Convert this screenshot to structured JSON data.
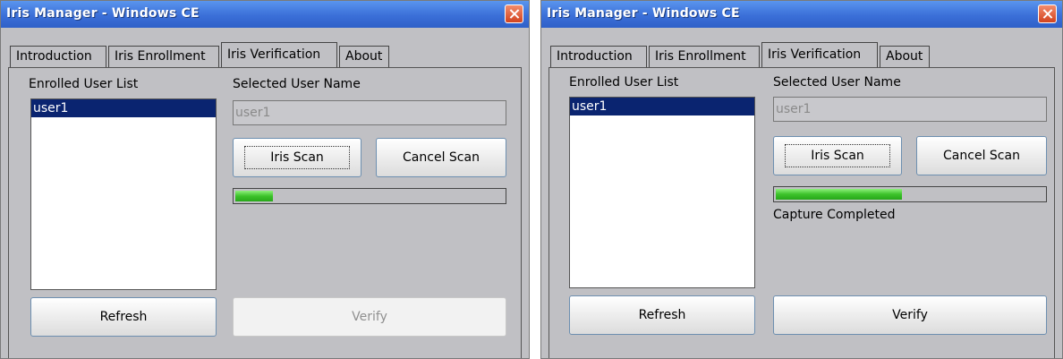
{
  "windows": [
    {
      "title": "Iris Manager - Windows CE",
      "tabs": [
        "Introduction",
        "Iris Enrollment",
        "Iris Verification",
        "About"
      ],
      "active_tab": "Iris Verification",
      "enrolled_label": "Enrolled User List",
      "users": [
        "user1"
      ],
      "selected_name_label": "Selected User Name",
      "selected_name_value": "user1",
      "scan_button": "Iris Scan",
      "cancel_button": "Cancel Scan",
      "progress": 0.14,
      "status_text": "",
      "refresh_button": "Refresh",
      "verify_button": "Verify",
      "verify_enabled": false
    },
    {
      "title": "Iris Manager - Windows CE",
      "tabs": [
        "Introduction",
        "Iris Enrollment",
        "Iris Verification",
        "About"
      ],
      "active_tab": "Iris Verification",
      "enrolled_label": "Enrolled User List",
      "users": [
        "user1"
      ],
      "selected_name_label": "Selected User Name",
      "selected_name_value": "user1",
      "scan_button": "Iris Scan",
      "cancel_button": "Cancel Scan",
      "progress": 0.47,
      "status_text": "Capture Completed",
      "refresh_button": "Refresh",
      "verify_button": "Verify",
      "verify_enabled": true
    }
  ],
  "colors": {
    "titlebar": "#3b6fd8",
    "window_bg": "#c0c0c4",
    "selection": "#0a2470",
    "progress_fill": "#3cc22a"
  }
}
